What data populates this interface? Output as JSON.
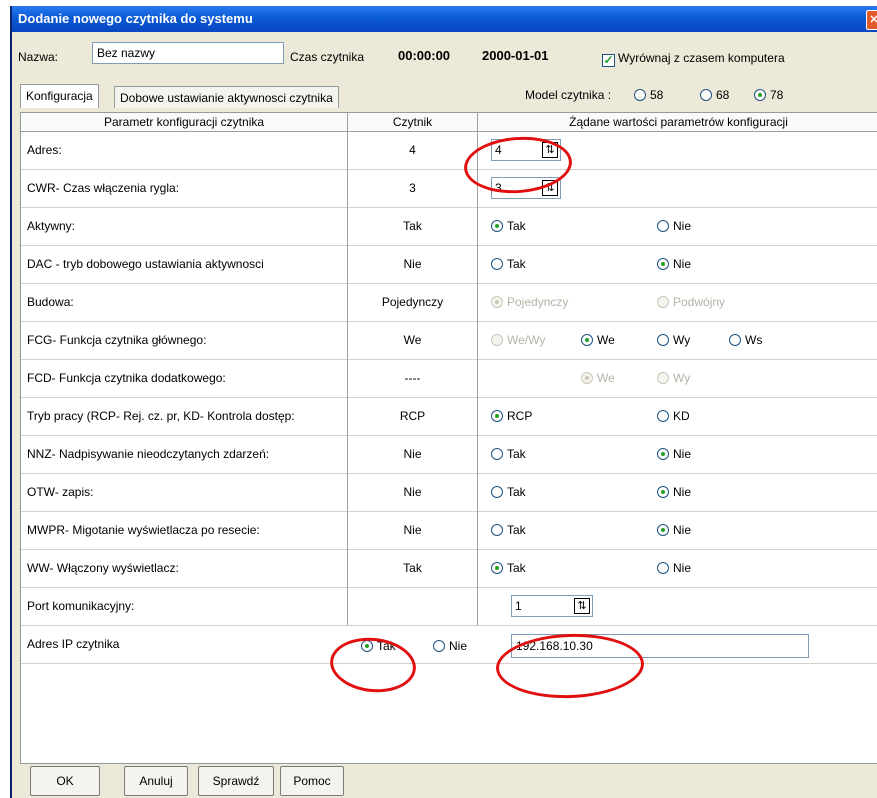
{
  "window": {
    "title": "Dodanie nowego czytnika do systemu",
    "close_icon": "close-icon"
  },
  "header": {
    "name_label": "Nazwa:",
    "name_value": "Bez nazwy",
    "time_label": "Czas czytnika",
    "time_value": "00:00:00",
    "date_value": "2000-01-01",
    "sync_label": "Wyrównaj z czasem komputera",
    "sync_checked": true
  },
  "tabs": [
    {
      "label": "Konfiguracja",
      "active": true
    },
    {
      "label": "Dobowe ustawianie aktywnosci czytnika",
      "active": false
    }
  ],
  "model": {
    "label": "Model czytnika :",
    "options": [
      "58",
      "68",
      "78"
    ],
    "selected": "78"
  },
  "table": {
    "headers": [
      "Parametr konfiguracji czytnika",
      "Czytnik",
      "Żądane wartości parametrów konfiguracji"
    ],
    "rows": [
      {
        "param": "Adres:",
        "reader": "4",
        "spin": "4"
      },
      {
        "param": "CWR- Czas włączenia rygla:",
        "reader": "3",
        "spin": "3"
      },
      {
        "param": "Aktywny:",
        "reader": "Tak",
        "options": [
          "Tak",
          "Nie"
        ],
        "selected": "Tak"
      },
      {
        "param": "DAC - tryb dobowego ustawiania aktywnosci",
        "reader": "Nie",
        "options": [
          "Tak",
          "Nie"
        ],
        "selected": "Nie"
      },
      {
        "param": "Budowa:",
        "reader": "Pojedynczy",
        "options": [
          "Pojedynczy",
          "Podwójny"
        ],
        "selected": "Pojedynczy"
      },
      {
        "param": "FCG- Funkcja czytnika głównego:",
        "reader": "We",
        "options": [
          "We/Wy",
          "We",
          "Wy",
          "Ws"
        ],
        "selected": "We"
      },
      {
        "param": "FCD- Funkcja czytnika dodatkowego:",
        "reader": "----",
        "options": [
          "We",
          "Wy"
        ],
        "selected": "We"
      },
      {
        "param": "Tryb pracy (RCP- Rej. cz. pr, KD- Kontrola dostęp:",
        "reader": "RCP",
        "options": [
          "RCP",
          "KD"
        ],
        "selected": "RCP"
      },
      {
        "param": "NNZ- Nadpisywanie nieodczytanych zdarzeń:",
        "reader": "Nie",
        "options": [
          "Tak",
          "Nie"
        ],
        "selected": "Nie"
      },
      {
        "param": "OTW- zapis:",
        "reader": "Nie",
        "options": [
          "Tak",
          "Nie"
        ],
        "selected": "Nie"
      },
      {
        "param": "MWPR- Migotanie wyświetlacza po resecie:",
        "reader": "Nie",
        "options": [
          "Tak",
          "Nie"
        ],
        "selected": "Nie"
      },
      {
        "param": "WW- Włączony wyświetlacz:",
        "reader": "Tak",
        "options": [
          "Tak",
          "Nie"
        ],
        "selected": "Tak"
      },
      {
        "param": "Port komunikacyjny:",
        "reader": "",
        "spin": "1"
      },
      {
        "param": "Adres IP czytnika",
        "options": [
          "Tak",
          "Nie"
        ],
        "selected": "Tak",
        "ip": "192.168.10.30"
      }
    ]
  },
  "buttons": [
    "OK",
    "Anuluj",
    "Sprawdź",
    "Pomoc"
  ],
  "colors": {
    "title_bar": "#0a5ad6",
    "radio_selected": "#21a121",
    "annotation": "#e01010"
  }
}
